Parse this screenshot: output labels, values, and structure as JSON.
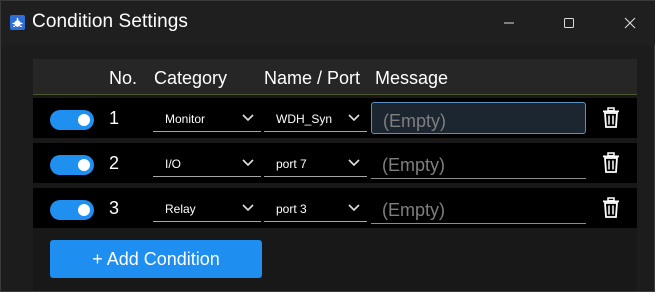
{
  "window": {
    "title": "Condition Settings",
    "icon": "app-bug-icon",
    "controls": [
      "minimize-icon",
      "maximize-icon",
      "close-icon"
    ]
  },
  "table": {
    "headers": {
      "no": "No.",
      "category": "Category",
      "name_port": "Name / Port",
      "message": "Message"
    },
    "rows": [
      {
        "enabled": true,
        "number": "1",
        "category": "Monitor",
        "name_port": "WDH_Syn",
        "message": "",
        "message_placeholder": "(Empty)",
        "focused": true
      },
      {
        "enabled": true,
        "number": "2",
        "category": "I/O",
        "name_port": "port 7",
        "message": "",
        "message_placeholder": "(Empty)",
        "focused": false
      },
      {
        "enabled": true,
        "number": "3",
        "category": "Relay",
        "name_port": "port 3",
        "message": "",
        "message_placeholder": "(Empty)",
        "focused": false
      }
    ]
  },
  "add_button": {
    "label": "+ Add Condition"
  },
  "colors": {
    "accent": "#1e8ef0",
    "background": "#1c1c1c",
    "row_background": "#000000",
    "header_background": "#262626",
    "placeholder": "#7f7f7f"
  }
}
